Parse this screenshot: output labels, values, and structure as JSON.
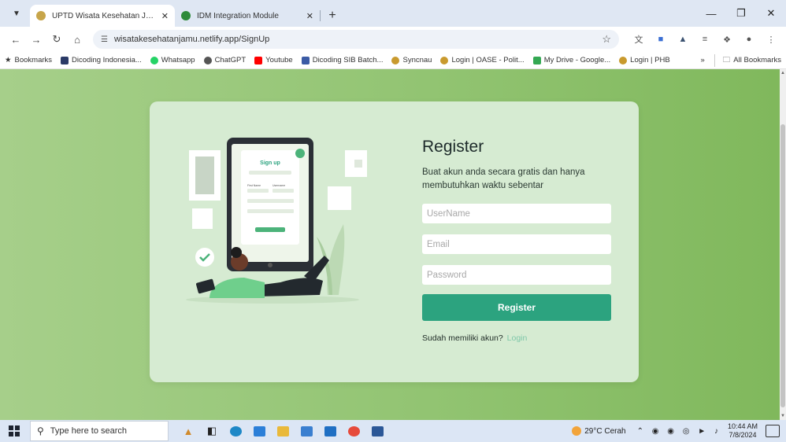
{
  "browser": {
    "tabs": [
      {
        "title": "UPTD Wisata Kesehatan Jamu",
        "active": true,
        "favicon_color": "#c7a54a"
      },
      {
        "title": "IDM Integration Module",
        "active": false,
        "favicon_color": "#2e8b3a"
      }
    ],
    "new_tab_label": "+",
    "url": "wisatakesehatanjamu.netlify.app/SignUp",
    "bookmarks": [
      {
        "label": "Bookmarks",
        "icon_color": "#444444"
      },
      {
        "label": "Dicoding Indonesia...",
        "icon_color": "#2b3a67"
      },
      {
        "label": "Whatsapp",
        "icon_color": "#25d366"
      },
      {
        "label": "ChatGPT",
        "icon_color": "#555555"
      },
      {
        "label": "Youtube",
        "icon_color": "#ff0000"
      },
      {
        "label": "Dicoding SIB Batch...",
        "icon_color": "#3b5ba5"
      },
      {
        "label": "Syncnau",
        "icon_color": "#c99a2e"
      },
      {
        "label": "Login | OASE - Polit...",
        "icon_color": "#c99a2e"
      },
      {
        "label": "My Drive - Google...",
        "icon_color": "#34a853"
      },
      {
        "label": "Login | PHB",
        "icon_color": "#c99a2e"
      }
    ],
    "bookmarks_more": "»",
    "all_bookmarks": "All Bookmarks"
  },
  "register": {
    "title": "Register",
    "subtitle": "Buat akun anda secara gratis dan hanya membutuhkan waktu sebentar",
    "username_placeholder": "UserName",
    "email_placeholder": "Email",
    "password_placeholder": "Password",
    "submit_label": "Register",
    "login_prompt": "Sudah memiliki akun?",
    "login_link": "Login"
  },
  "illustration": {
    "phone_title": "Sign up",
    "phone_field_1": "First Name",
    "phone_field_2": "Username"
  },
  "taskbar": {
    "search_placeholder": "Type here to search",
    "weather": "29°C  Cerah",
    "time": "10:44 AM",
    "date": "7/8/2024"
  },
  "colors": {
    "accent": "#2ca37f",
    "page_bg": "#92c472",
    "card_bg": "#d6ebd2",
    "link": "#7fc7a9"
  }
}
